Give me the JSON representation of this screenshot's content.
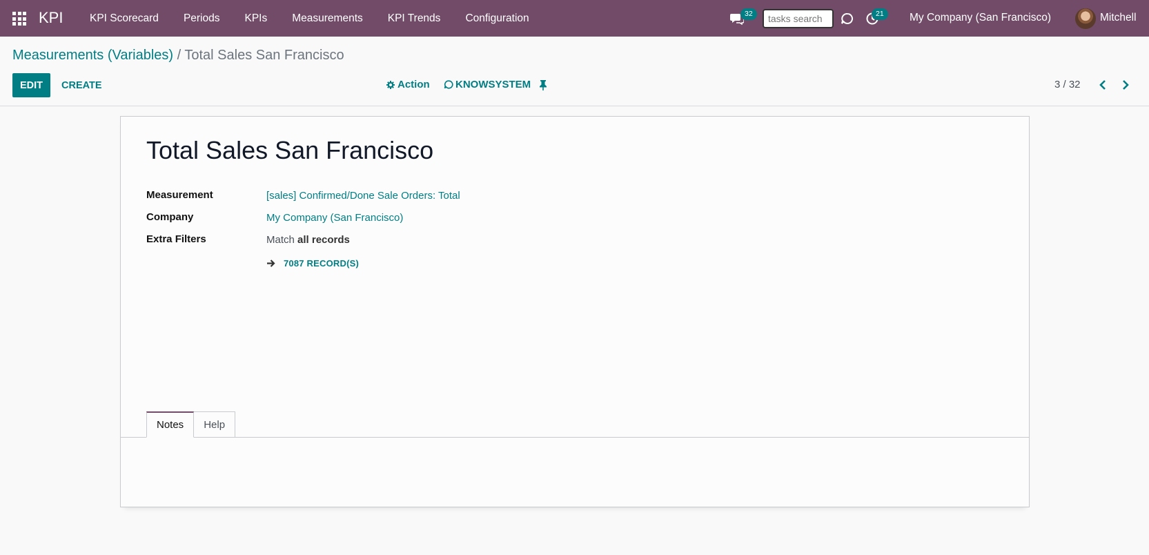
{
  "navbar": {
    "brand": "KPI",
    "menu": [
      "KPI Scorecard",
      "Periods",
      "KPIs",
      "Measurements",
      "KPI Trends",
      "Configuration"
    ],
    "messages_count": "32",
    "search_placeholder": "tasks search",
    "activities_count": "21",
    "company": "My Company (San Francisco)",
    "user": "Mitchell"
  },
  "breadcrumb": {
    "parent": "Measurements (Variables)",
    "separator": "/",
    "current": "Total Sales San Francisco"
  },
  "buttons": {
    "edit": "EDIT",
    "create": "CREATE",
    "action": "Action",
    "knowsystem": "KNOWSYSTEM"
  },
  "pager": {
    "value": "3 / 32"
  },
  "record": {
    "title": "Total Sales San Francisco",
    "fields": {
      "measurement_label": "Measurement",
      "measurement_value": "[sales] Confirmed/Done Sale Orders: Total",
      "company_label": "Company",
      "company_value": "My Company (San Francisco)",
      "extra_filters_label": "Extra Filters",
      "extra_filters_prefix": "Match",
      "extra_filters_value": "all records",
      "records_count": "7087 RECORD(S)"
    }
  },
  "tabs": [
    "Notes",
    "Help"
  ],
  "colors": {
    "navbar": "#714b67",
    "accent": "#017e84"
  }
}
